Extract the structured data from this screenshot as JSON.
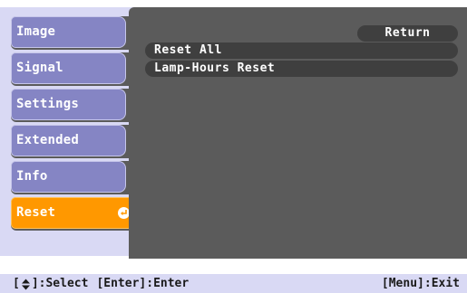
{
  "sidebar": {
    "items": [
      {
        "label": "Image",
        "active": false
      },
      {
        "label": "Signal",
        "active": false
      },
      {
        "label": "Settings",
        "active": false
      },
      {
        "label": "Extended",
        "active": false
      },
      {
        "label": "Info",
        "active": false
      },
      {
        "label": "Reset",
        "active": true,
        "icon": "enter-icon"
      }
    ]
  },
  "panel": {
    "return_label": "Return",
    "options": [
      {
        "label": "Reset All"
      },
      {
        "label": "Lamp-Hours Reset"
      }
    ]
  },
  "statusbar": {
    "select_prefix": "[",
    "select_icon": "up-down-arrow-icon",
    "select_suffix": "]:Select",
    "enter_hint": "[Enter]:Enter",
    "exit_hint": "[Menu]:Exit"
  },
  "colors": {
    "menu_item": "#8585c4",
    "menu_active": "#ff9800",
    "panel": "#5b5b5b",
    "pill": "#3f3f3f",
    "sidebar_bg": "#d9d9f4"
  }
}
